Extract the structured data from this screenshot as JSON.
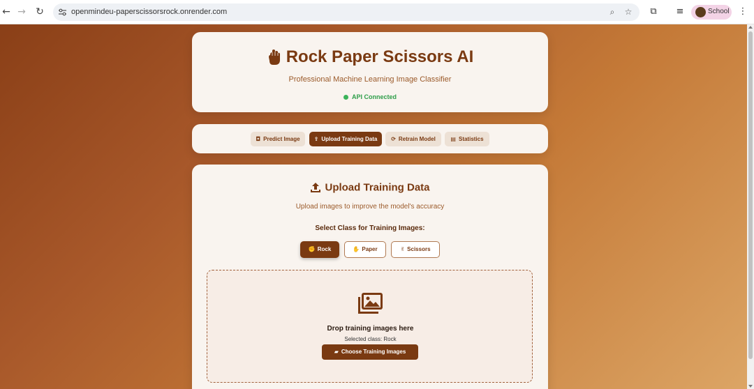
{
  "browser": {
    "url": "openmindeu-paperscissorsrock.onrender.com",
    "profile_label": "School"
  },
  "header": {
    "title": "Rock Paper Scissors AI",
    "subtitle": "Professional Machine Learning Image Classifier",
    "status": "API Connected",
    "status_color": "#3bb35a"
  },
  "tabs": [
    {
      "label": "Predict Image",
      "icon": "camera-icon",
      "active": false
    },
    {
      "label": "Upload Training Data",
      "icon": "upload-icon",
      "active": true
    },
    {
      "label": "Retrain Model",
      "icon": "sync-icon",
      "active": false
    },
    {
      "label": "Statistics",
      "icon": "chart-icon",
      "active": false
    }
  ],
  "upload": {
    "title": "Upload Training Data",
    "subtitle": "Upload images to improve the model's accuracy",
    "select_label": "Select Class for Training Images:",
    "classes": [
      {
        "label": "Rock",
        "icon": "rock-hand-icon",
        "selected": true
      },
      {
        "label": "Paper",
        "icon": "paper-hand-icon",
        "selected": false
      },
      {
        "label": "Scissors",
        "icon": "scissors-hand-icon",
        "selected": false
      }
    ],
    "drop_title": "Drop training images here",
    "selected_class_text": "Selected class: Rock",
    "choose_button": "Choose Training Images"
  },
  "colors": {
    "accent": "#7a3a12",
    "card_bg": "#f9f4ef"
  }
}
